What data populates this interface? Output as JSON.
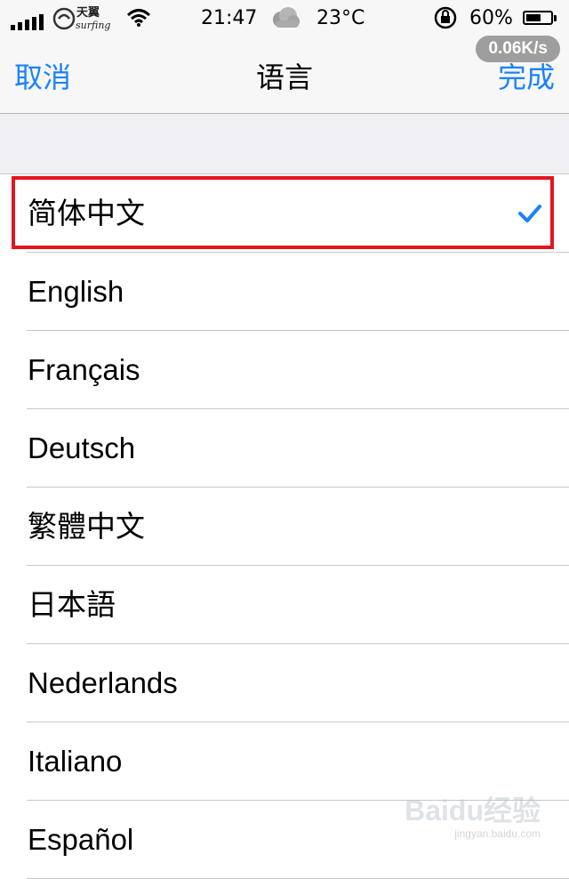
{
  "status_bar": {
    "carrier_logo": "天翼 surfing",
    "time": "21:47",
    "temperature": "23°C",
    "battery_percent": "60%",
    "battery_level": 0.6,
    "signal_bars": 5,
    "icons": [
      "signal-icon",
      "carrier-logo",
      "wifi-icon",
      "weather-cloud-icon",
      "rotation-lock-icon",
      "battery-icon"
    ]
  },
  "nav": {
    "cancel_label": "取消",
    "title": "语言",
    "done_label": "完成",
    "speed_badge": "0.06K/s"
  },
  "languages": [
    {
      "label": "简体中文",
      "selected": true
    },
    {
      "label": "English",
      "selected": false
    },
    {
      "label": "Français",
      "selected": false
    },
    {
      "label": "Deutsch",
      "selected": false
    },
    {
      "label": "繁體中文",
      "selected": false
    },
    {
      "label": "日本語",
      "selected": false
    },
    {
      "label": "Nederlands",
      "selected": false
    },
    {
      "label": "Italiano",
      "selected": false
    },
    {
      "label": "Español",
      "selected": false
    }
  ],
  "colors": {
    "accent": "#1a82fb",
    "highlight_border": "#e3151f",
    "group_background": "#efeff4"
  },
  "watermark": {
    "logo": "Baidu经验",
    "url": "jingyan.baidu.com"
  }
}
